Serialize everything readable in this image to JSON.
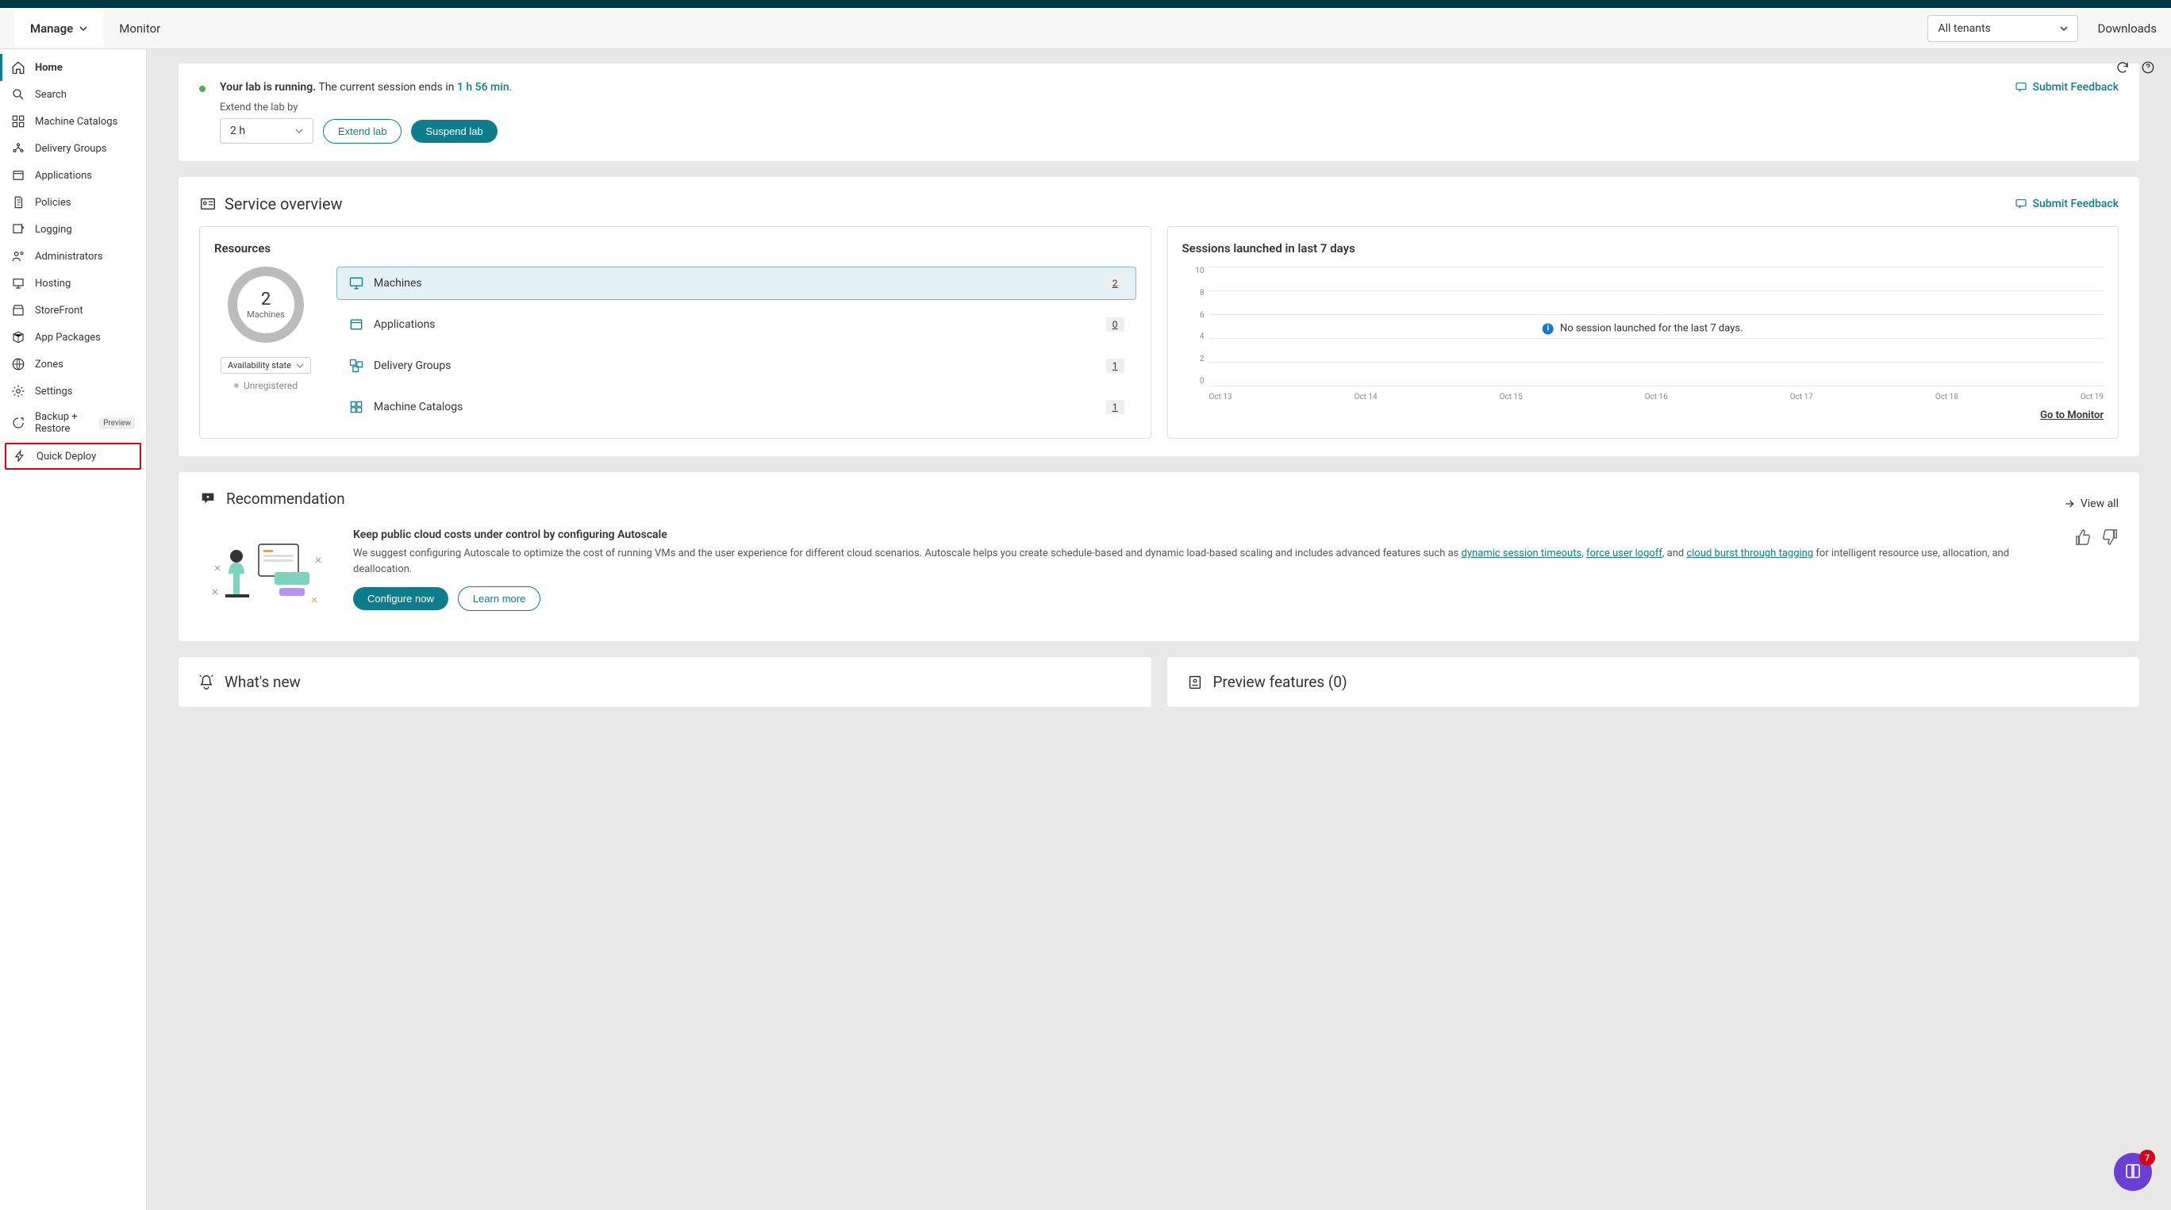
{
  "topnav": {
    "manage": "Manage",
    "monitor": "Monitor",
    "tenant_selected": "All tenants",
    "downloads": "Downloads"
  },
  "sidebar": {
    "items": [
      {
        "label": "Home"
      },
      {
        "label": "Search"
      },
      {
        "label": "Machine Catalogs"
      },
      {
        "label": "Delivery Groups"
      },
      {
        "label": "Applications"
      },
      {
        "label": "Policies"
      },
      {
        "label": "Logging"
      },
      {
        "label": "Administrators"
      },
      {
        "label": "Hosting"
      },
      {
        "label": "StoreFront"
      },
      {
        "label": "App Packages"
      },
      {
        "label": "Zones"
      },
      {
        "label": "Settings"
      },
      {
        "label": "Backup + Restore"
      },
      {
        "label": "Quick Deploy"
      }
    ],
    "preview_badge": "Preview"
  },
  "lab": {
    "running_text": "Your lab is running.",
    "session_text": "The current session ends in ",
    "time_left": "1 h 56 min",
    "period": ".",
    "extend_label": "Extend the lab by",
    "hours": "2 h",
    "extend_btn": "Extend lab",
    "suspend_btn": "Suspend lab",
    "feedback": "Submit Feedback"
  },
  "overview": {
    "title": "Service overview",
    "feedback": "Submit Feedback",
    "resources": {
      "title": "Resources",
      "donut_count": "2",
      "donut_label": "Machines",
      "availability_label": "Availability state",
      "legend_unreg": "Unregistered",
      "rows": [
        {
          "label": "Machines",
          "count": "2"
        },
        {
          "label": "Applications",
          "count": "0"
        },
        {
          "label": "Delivery Groups",
          "count": "1"
        },
        {
          "label": "Machine Catalogs",
          "count": "1"
        }
      ]
    },
    "sessions": {
      "title": "Sessions launched in last 7 days",
      "no_session_msg": "No session launched for the last 7 days.",
      "monitor_link": "Go to Monitor"
    }
  },
  "chart_data": {
    "type": "line",
    "categories": [
      "Oct 13",
      "Oct 14",
      "Oct 15",
      "Oct 16",
      "Oct 17",
      "Oct 18",
      "Oct 19"
    ],
    "values": [
      0,
      0,
      0,
      0,
      0,
      0,
      0
    ],
    "title": "Sessions launched in last 7 days",
    "xlabel": "",
    "ylabel": "",
    "ylim": [
      0,
      10
    ],
    "yticks": [
      0,
      2,
      4,
      6,
      8,
      10
    ]
  },
  "reco": {
    "head": "Recommendation",
    "view_all": "View all",
    "title": "Keep public cloud costs under control by configuring Autoscale",
    "text_pre": "We suggest configuring Autoscale to optimize the cost of running VMs and the user experience for different cloud scenarios. Autoscale helps you create schedule-based and dynamic load-based scaling and includes advanced features such as ",
    "link1": "dynamic session timeouts",
    "sep1": ", ",
    "link2": "force user logoff",
    "sep2": ", and ",
    "link3": "cloud burst through tagging",
    "text_post": " for intelligent resource use, allocation, and deallocation.",
    "configure": "Configure now",
    "learn": "Learn more"
  },
  "bottom": {
    "whats_new": "What's new",
    "preview": "Preview features (0)"
  },
  "fab": {
    "badge": "7"
  }
}
